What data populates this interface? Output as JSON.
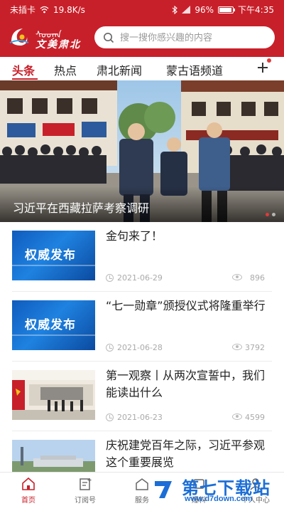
{
  "status_bar": {
    "carrier": "未插卡",
    "network_speed": "19.8K/s",
    "battery": "96%",
    "time": "下午4:35"
  },
  "header": {
    "logo_mongolian": "ᠰᠤᠤᠨᠠᠨ",
    "logo_text": "文美肃北",
    "search_placeholder": "搜一搜你感兴趣的内容"
  },
  "tabs": [
    {
      "label": "头条",
      "active": true
    },
    {
      "label": "热点",
      "active": false
    },
    {
      "label": "肃北新闻",
      "active": false
    },
    {
      "label": "蒙古语频道",
      "active": false
    }
  ],
  "banner": {
    "caption": "习近平在西藏拉萨考察调研"
  },
  "news": [
    {
      "title": "金句来了！",
      "date": "2021-06-29",
      "views": "896",
      "thumb_text": "权威发布"
    },
    {
      "title": "“七一勋章”颁授仪式将隆重举行",
      "date": "2021-06-28",
      "views": "3792",
      "thumb_text": "权威发布"
    },
    {
      "title": "第一观察丨从两次宣誓中，我们能读出什么",
      "date": "2021-06-23",
      "views": "4599"
    },
    {
      "title": "庆祝建党百年之际，习近平参观这个重要展览"
    }
  ],
  "bottom_nav": [
    {
      "label": "首页",
      "icon": "home-icon",
      "active": true
    },
    {
      "label": "订阅号",
      "icon": "subscribe-icon",
      "active": false
    },
    {
      "label": "服务",
      "icon": "service-icon",
      "active": false
    },
    {
      "label": "爆料",
      "icon": "report-icon",
      "active": false
    },
    {
      "label": "个人中心",
      "icon": "user-icon",
      "active": false
    }
  ],
  "watermark": {
    "text": "第七下载站",
    "url": "www.d7down.com"
  },
  "colors": {
    "brand_red": "#c8202a",
    "watermark_blue": "#1c6ed6"
  }
}
